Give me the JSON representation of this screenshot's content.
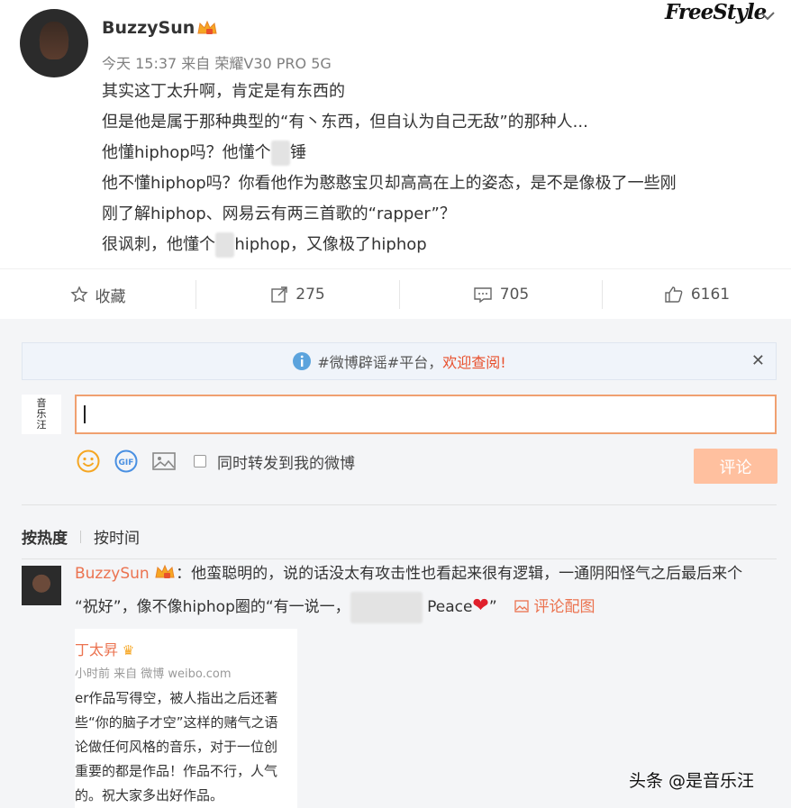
{
  "post": {
    "username": "BuzzySun",
    "meta": "今天 15:37 来自 荣耀V30 PRO 5G",
    "brand_logo": "FreeStyle",
    "lines": [
      "其实这丁太升啊，肯定是有东西的",
      "但是他是属于那种典型的“有丶东西，但自认为自己无敌”的那种人...",
      "他懂hiphop吗？他懂个",
      "锤",
      "他不懂hiphop吗？你看他作为憨憨宝贝却高高在上的姿态，是不是像极了一些刚",
      "刚了解hiphop、网易云有两三首歌的“rapper”？",
      "很讽刺，他懂个",
      "hiphop，又像极了hiphop"
    ]
  },
  "actions": {
    "favorite": "收藏",
    "repost": "275",
    "comment": "705",
    "like": "6161"
  },
  "notice": {
    "text": "#微博辟谣#平台，",
    "highlight": "欢迎查阅!"
  },
  "composer": {
    "avatar_text": [
      "音",
      "乐",
      "汪"
    ],
    "repost_checkbox_label": "同时转发到我的微博",
    "submit_label": "评论"
  },
  "sort": {
    "hot": "按热度",
    "time": "按时间"
  },
  "comment": {
    "username": "BuzzySun",
    "text_line1": "：他蛮聪明的，说的话没太有攻击性也看起来很有逻辑，一通阴阳怪气之后最后来个",
    "text_line2a": "“祝好”，像不像hiphop圈的“有一说一，",
    "text_line2b": "Peace",
    "text_line2c": "”",
    "pic_link": "评论配图"
  },
  "screenshot_text": {
    "name": "丁太昇",
    "meta": "小时前  来自 微博 weibo.com",
    "lines": [
      "er作品写得空，被人指出之后还著",
      "些“你的脑子才空”这样的赌气之语",
      "论做任何风格的音乐，对于一位创",
      "重要的都是作品！作品不行，人气",
      "的。祝大家多出好作品。"
    ]
  },
  "watermark": "头条 @是音乐汪",
  "colors": {
    "accent_orange": "#eb7350",
    "submit_disabled": "#ffc09f",
    "input_border": "#f0a070",
    "panel_bg": "#f4f5f7"
  }
}
